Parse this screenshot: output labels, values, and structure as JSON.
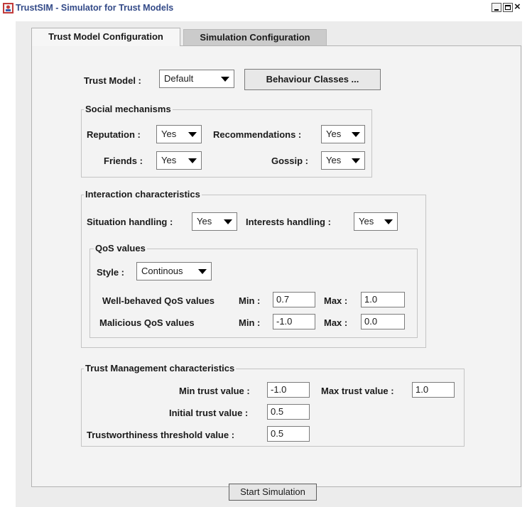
{
  "window": {
    "title": "TrustSIM - Simulator for Trust Models",
    "controls": {
      "minimize": "_",
      "maximize": "□",
      "close": "×"
    }
  },
  "tabs": [
    {
      "label": "Trust Model Configuration",
      "active": true
    },
    {
      "label": "Simulation Configuration",
      "active": false
    }
  ],
  "trust_model": {
    "label": "Trust Model :",
    "value": "Default"
  },
  "behaviour_button": {
    "label": "Behaviour Classes ..."
  },
  "social": {
    "title": "Social mechanisms",
    "reputation": {
      "label": "Reputation :",
      "value": "Yes"
    },
    "recommendations": {
      "label": "Recommendations :",
      "value": "Yes"
    },
    "friends": {
      "label": "Friends :",
      "value": "Yes"
    },
    "gossip": {
      "label": "Gossip :",
      "value": "Yes"
    }
  },
  "interaction": {
    "title": "Interaction characteristics",
    "situation": {
      "label": "Situation handling :",
      "value": "Yes"
    },
    "interests": {
      "label": "Interests handling :",
      "value": "Yes"
    },
    "qos": {
      "title": "QoS values",
      "style": {
        "label": "Style :",
        "value": "Continous"
      },
      "well_behaved": {
        "label": "Well-behaved QoS values",
        "min_label": "Min :",
        "min": "0.7",
        "max_label": "Max :",
        "max": "1.0"
      },
      "malicious": {
        "label": "Malicious QoS values",
        "min_label": "Min :",
        "min": "-1.0",
        "max_label": "Max :",
        "max": "0.0"
      }
    }
  },
  "trust_mgmt": {
    "title": "Trust Management characteristics",
    "min_trust": {
      "label": "Min trust value :",
      "value": "-1.0"
    },
    "max_trust": {
      "label": "Max trust value :",
      "value": "1.0"
    },
    "initial": {
      "label": "Initial trust value :",
      "value": "0.5"
    },
    "threshold": {
      "label": "Trustworthiness threshold value :",
      "value": "0.5"
    }
  },
  "start_button": {
    "label": "Start Simulation"
  }
}
